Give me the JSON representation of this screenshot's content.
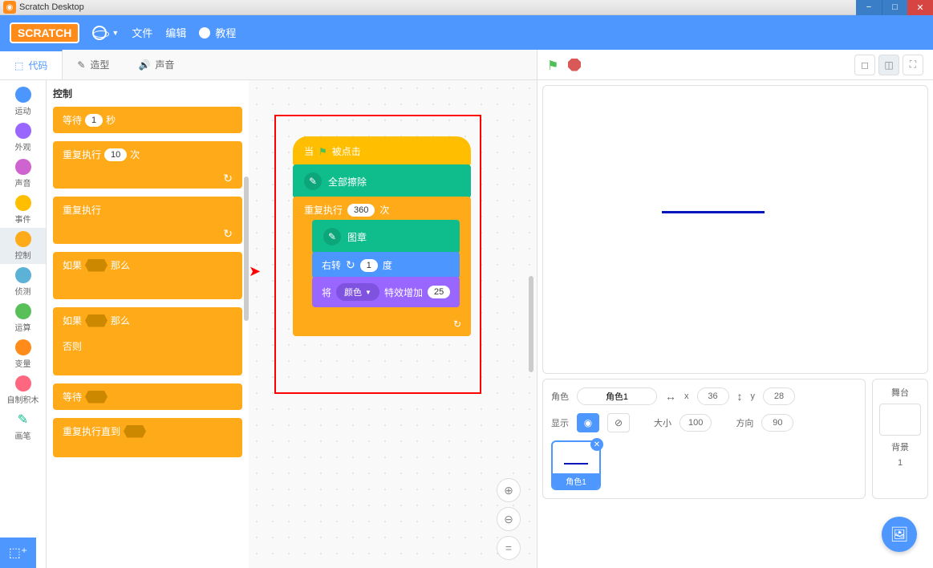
{
  "titlebar": {
    "title": "Scratch Desktop"
  },
  "menubar": {
    "logo": "SCRATCH",
    "file": "文件",
    "edit": "编辑",
    "tutorials": "教程"
  },
  "tabs": {
    "code": "代码",
    "costumes": "造型",
    "sounds": "声音"
  },
  "categories": [
    {
      "name": "运动",
      "color": "#4c97ff"
    },
    {
      "name": "外观",
      "color": "#9966ff"
    },
    {
      "name": "声音",
      "color": "#cf63cf"
    },
    {
      "name": "事件",
      "color": "#ffbf00"
    },
    {
      "name": "控制",
      "color": "#ffab19"
    },
    {
      "name": "侦测",
      "color": "#5cb1d6"
    },
    {
      "name": "运算",
      "color": "#59c059"
    },
    {
      "name": "变量",
      "color": "#ff8c1a"
    },
    {
      "name": "自制积木",
      "color": "#ff6680"
    },
    {
      "name": "画笔",
      "color": "#0fbd8c"
    }
  ],
  "palette": {
    "title": "控制",
    "wait": {
      "prefix": "等待",
      "val": "1",
      "suffix": "秒"
    },
    "repeat": {
      "prefix": "重复执行",
      "val": "10",
      "suffix": "次"
    },
    "forever": "重复执行",
    "if": {
      "prefix": "如果",
      "suffix": "那么"
    },
    "ifelse": {
      "prefix": "如果",
      "suffix": "那么",
      "else": "否则"
    },
    "waituntil": "等待",
    "repeatuntil": "重复执行直到"
  },
  "script": {
    "hat": {
      "prefix": "当",
      "suffix": "被点击"
    },
    "eraseall": "全部擦除",
    "repeat": {
      "prefix": "重复执行",
      "val": "360",
      "suffix": "次"
    },
    "stamp": "图章",
    "turn": {
      "prefix": "右转",
      "val": "1",
      "suffix": "度"
    },
    "effect": {
      "prefix": "将",
      "dropdown": "颜色",
      "mid": "特效增加",
      "val": "25"
    }
  },
  "sprite_info": {
    "sprite_label": "角色",
    "sprite_name": "角色1",
    "x_label": "x",
    "x_val": "36",
    "y_label": "y",
    "y_val": "28",
    "show_label": "显示",
    "size_label": "大小",
    "size_val": "100",
    "dir_label": "方向",
    "dir_val": "90"
  },
  "sprites": {
    "thumb1": "角色1"
  },
  "stage_panel": {
    "label": "舞台",
    "backdrops_label": "背景",
    "count": "1"
  }
}
